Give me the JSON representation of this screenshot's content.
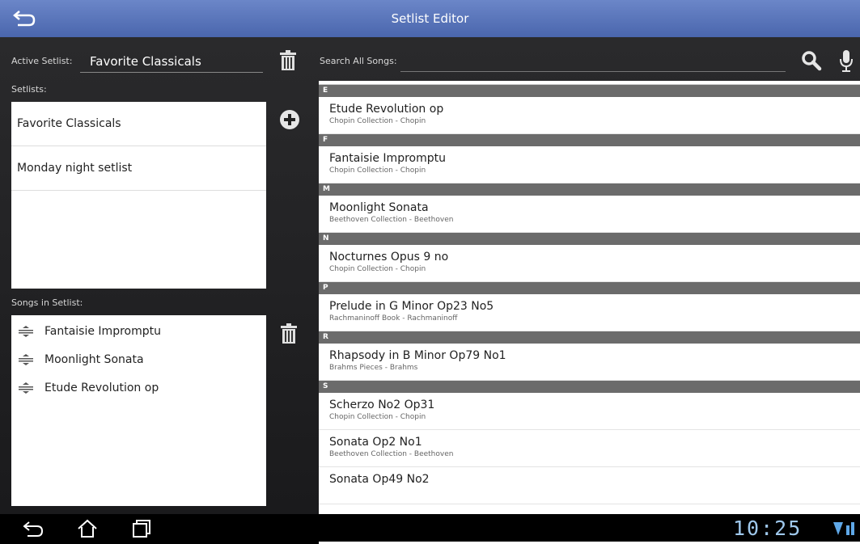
{
  "header": {
    "title": "Setlist Editor"
  },
  "left": {
    "active_label": "Active Setlist:",
    "active_value": "Favorite Classicals",
    "setlists_label": "Setlists:",
    "setlists": [
      {
        "name": "Favorite Classicals"
      },
      {
        "name": "Monday night setlist"
      }
    ],
    "songs_label": "Songs in Setlist:",
    "songs": [
      {
        "name": "Fantaisie Impromptu"
      },
      {
        "name": "Moonlight Sonata"
      },
      {
        "name": "Etude Revolution op"
      }
    ]
  },
  "right": {
    "search_label": "Search All Songs:",
    "search_value": "",
    "sections": [
      {
        "letter": "E",
        "songs": [
          {
            "title": "Etude Revolution op",
            "sub": "Chopin Collection - Chopin"
          }
        ]
      },
      {
        "letter": "F",
        "songs": [
          {
            "title": "Fantaisie Impromptu",
            "sub": "Chopin Collection - Chopin"
          }
        ]
      },
      {
        "letter": "M",
        "songs": [
          {
            "title": "Moonlight Sonata",
            "sub": "Beethoven Collection - Beethoven"
          }
        ]
      },
      {
        "letter": "N",
        "songs": [
          {
            "title": "Nocturnes Opus 9 no",
            "sub": "Chopin Collection - Chopin"
          }
        ]
      },
      {
        "letter": "P",
        "songs": [
          {
            "title": "Prelude in G Minor Op23 No5",
            "sub": "Rachmaninoff Book - Rachmaninoff"
          }
        ]
      },
      {
        "letter": "R",
        "songs": [
          {
            "title": "Rhapsody in B Minor Op79 No1",
            "sub": "Brahms Pieces - Brahms"
          }
        ]
      },
      {
        "letter": "S",
        "songs": [
          {
            "title": "Scherzo No2 Op31",
            "sub": "Chopin Collection - Chopin"
          },
          {
            "title": "Sonata Op2 No1",
            "sub": "Beethoven Collection - Beethoven"
          },
          {
            "title": "Sonata Op49 No2",
            "sub": ""
          }
        ]
      }
    ]
  },
  "statusbar": {
    "clock": "10:25"
  },
  "icons": {
    "back": "back-arrow-icon",
    "trash": "trash-icon",
    "add": "add-circle-icon",
    "search": "search-icon",
    "mic": "microphone-icon",
    "drag": "drag-handle-icon"
  }
}
